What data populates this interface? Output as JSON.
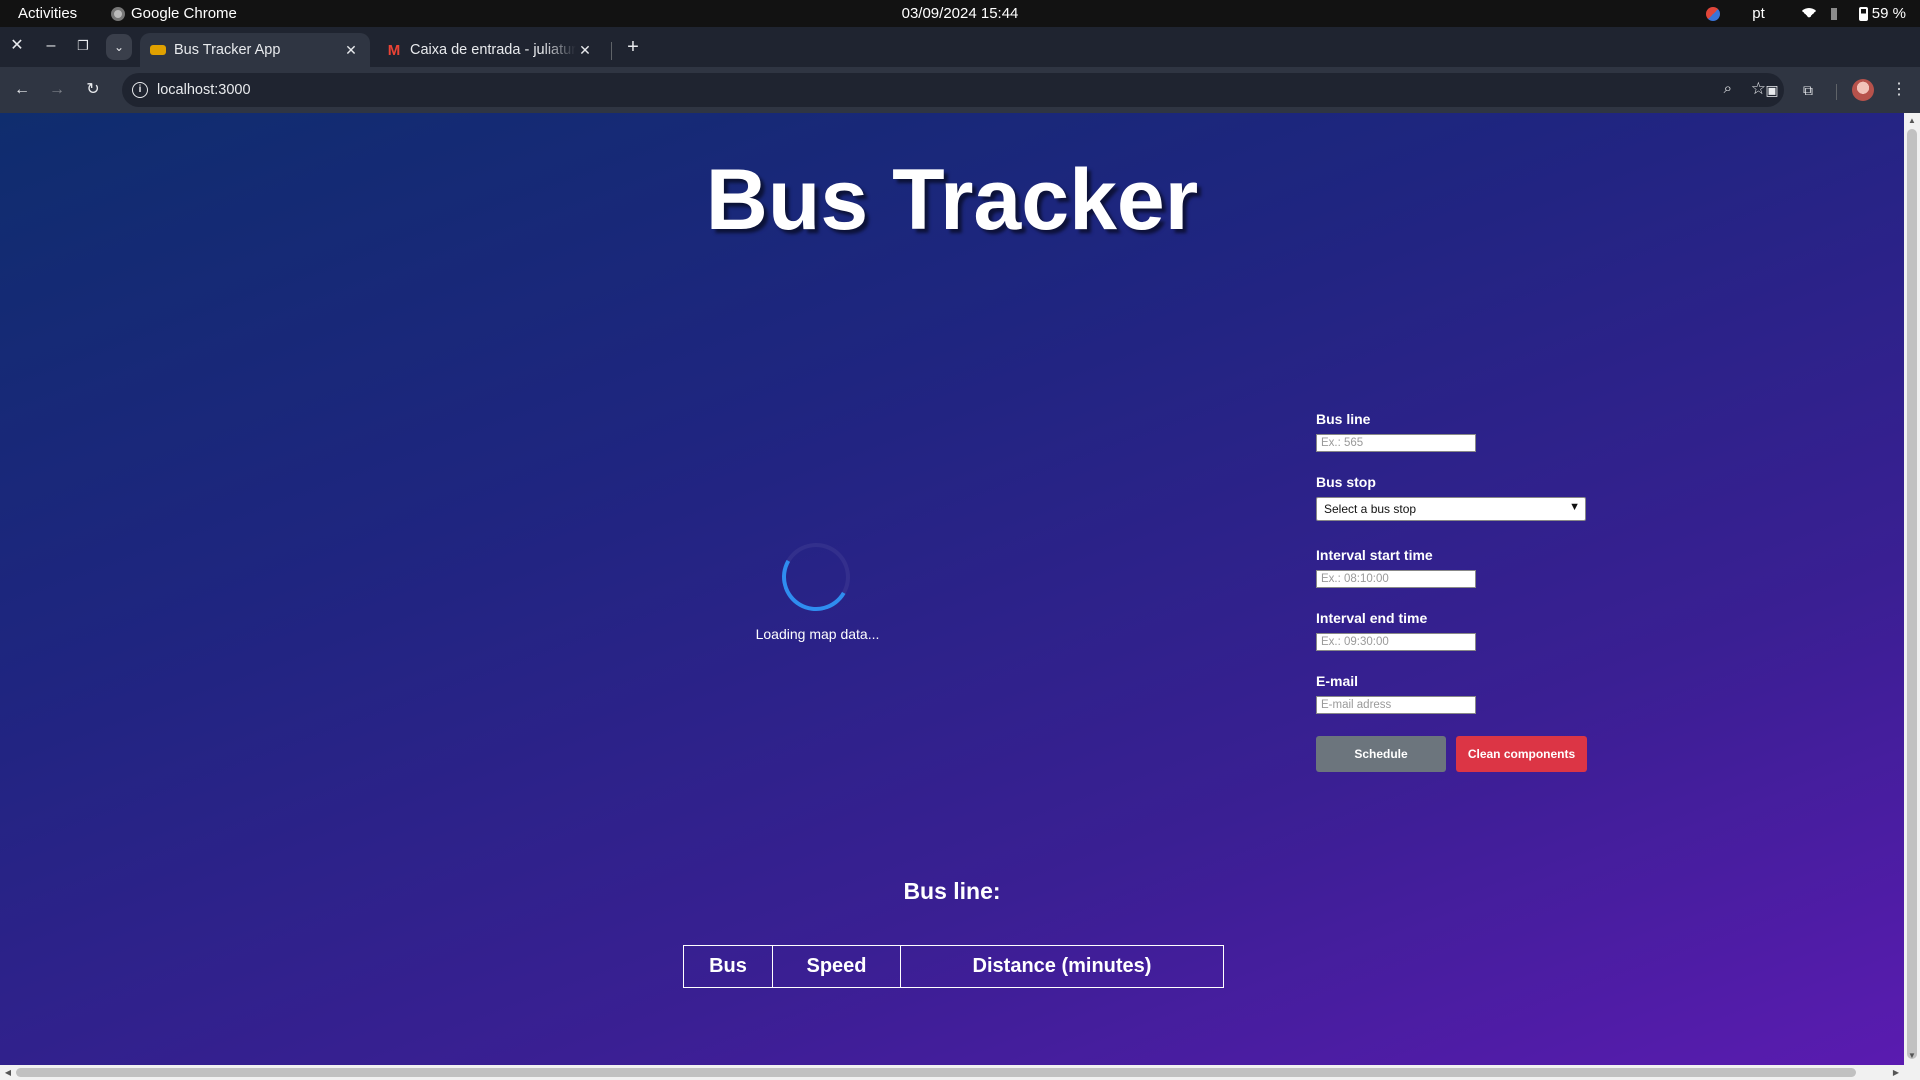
{
  "system": {
    "activities": "Activities",
    "app_name": "Google Chrome",
    "clock": "03/09/2024 15:44",
    "language": "pt",
    "battery": "59 %"
  },
  "browser": {
    "tabs": [
      {
        "title": "Bus Tracker App",
        "favicon": "bus-icon",
        "active": true
      },
      {
        "title": "Caixa de entrada - juliatura",
        "favicon": "gmail-icon",
        "active": false
      }
    ],
    "url": "localhost:3000"
  },
  "page": {
    "title": "Bus Tracker",
    "loading_text": "Loading map data...",
    "form": {
      "bus_line": {
        "label": "Bus line",
        "placeholder": "Ex.: 565"
      },
      "bus_stop": {
        "label": "Bus stop",
        "selected": "Select a bus stop"
      },
      "start_time": {
        "label": "Interval start time",
        "placeholder": "Ex.: 08:10:00"
      },
      "end_time": {
        "label": "Interval end time",
        "placeholder": "Ex.: 09:30:00"
      },
      "email": {
        "label": "E-mail",
        "placeholder": "E-mail adress"
      },
      "schedule_label": "Schedule",
      "clean_label": "Clean components"
    },
    "results": {
      "heading": "Bus line:",
      "columns": [
        "Bus",
        "Speed",
        "Distance (minutes)"
      ]
    }
  },
  "colors": {
    "schedule_button": "#6c757d",
    "clean_button": "#dc3545",
    "spinner": "#2f8df0",
    "background_start": "#0f2d6e",
    "background_end": "#5a1bb0"
  }
}
